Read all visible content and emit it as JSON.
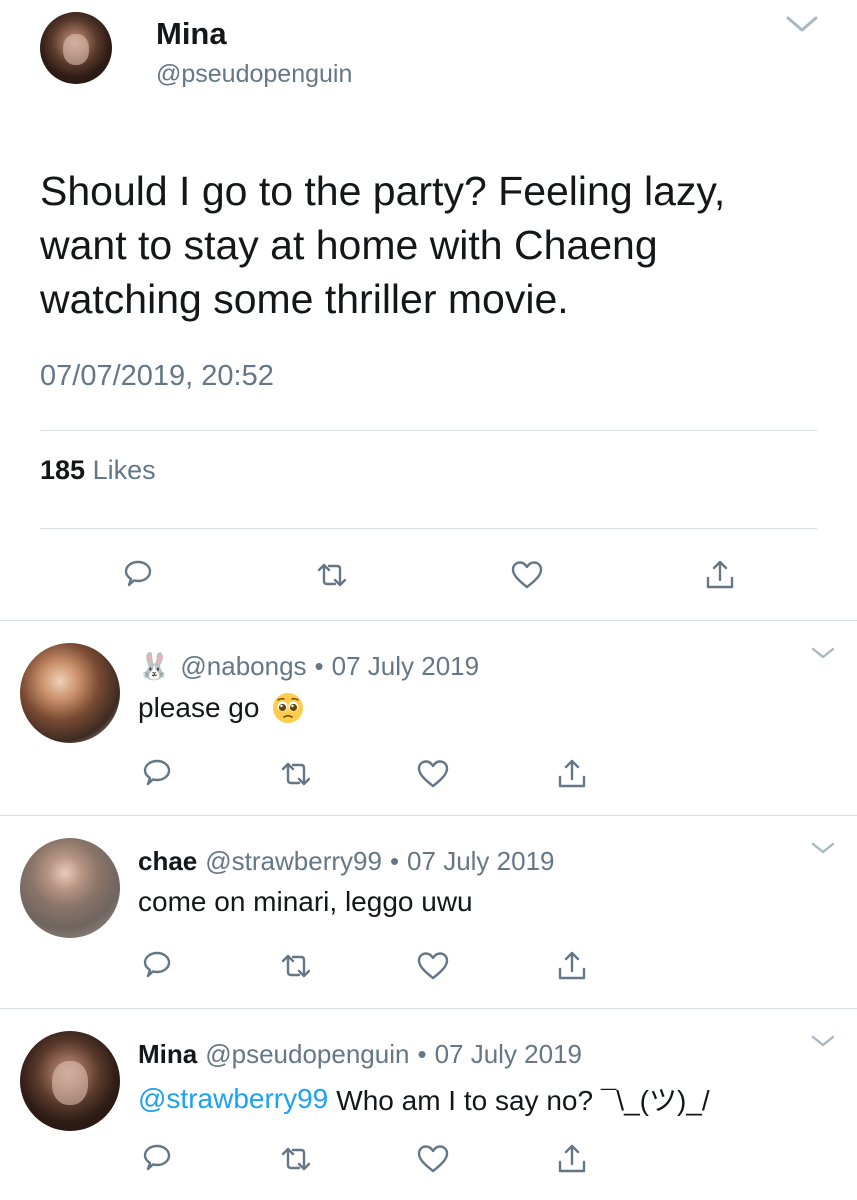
{
  "main_tweet": {
    "display_name": "Mina",
    "handle": "@pseudopenguin",
    "text": "Should I go to the party? Feeling lazy, want to stay at home with Chaeng watching some thriller movie.",
    "timestamp": "07/07/2019, 20:52",
    "likes_count": "185",
    "likes_label": "Likes"
  },
  "replies": [
    {
      "name": "",
      "name_emoji": "🐰",
      "handle": "@nabongs",
      "dot": "•",
      "date": "07 July 2019",
      "mention": "",
      "text": "please go",
      "text_emoji": "pleading-face-icon"
    },
    {
      "name": "chae",
      "handle": "@strawberry99",
      "dot": "•",
      "date": "07 July 2019",
      "mention": "",
      "text": "come on minari, leggo uwu"
    },
    {
      "name": "Mina",
      "handle": "@pseudopenguin",
      "dot": "•",
      "date": "07 July 2019",
      "mention": "@strawberry99",
      "text": "Who am I to say no? ¯\\_(ツ)_/"
    }
  ],
  "icons": {
    "reply": "reply-icon",
    "retweet": "retweet-icon",
    "like": "heart-icon",
    "share": "share-icon",
    "more": "chevron-down-icon"
  },
  "colors": {
    "text": "#14171a",
    "secondary": "#657786",
    "link": "#1da1f2",
    "divider": "#d6dde2"
  }
}
